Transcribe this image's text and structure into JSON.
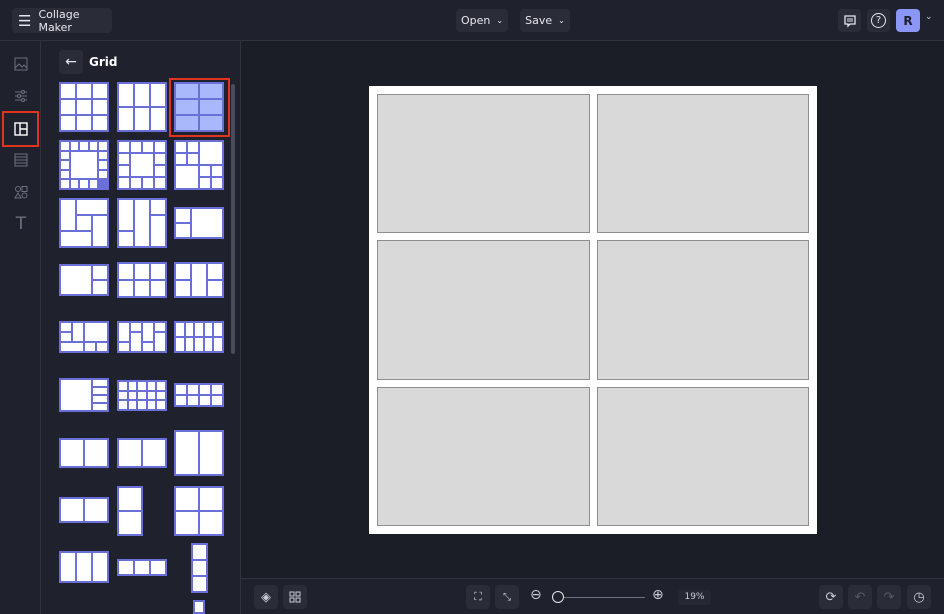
{
  "header": {
    "app_title": "Collage Maker",
    "open_label": "Open",
    "save_label": "Save",
    "avatar_initial": "R"
  },
  "panel": {
    "title": "Grid",
    "selected_layout_index": 2
  },
  "toolbar": {
    "zoom_value": "19%",
    "zoom_fraction": 0.05
  },
  "colors": {
    "accent": "#6b70d9",
    "selected": "#a9b8fb",
    "highlight": "#e0341f",
    "avatar": "#8b96f6"
  }
}
